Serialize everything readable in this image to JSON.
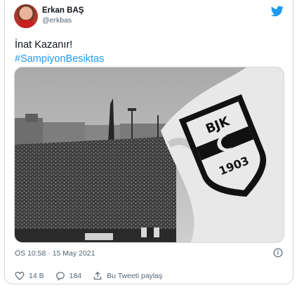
{
  "author": {
    "name": "Erkan BAŞ",
    "handle": "@erkbas"
  },
  "tweet": {
    "text": "İnat Kazanır!",
    "hashtag": "#SampiyonBesiktas",
    "timestamp": "ÖS 10:58 · 15 May 2021"
  },
  "media": {
    "flag_text": "BJK 1903"
  },
  "actions": {
    "likes": "14 B",
    "replies": "184",
    "share_label": "Bu Tweeti paylaş"
  },
  "colors": {
    "accent": "#1d9bf0",
    "secondary_text": "#536471",
    "border": "#cfd9de"
  },
  "icons": [
    "twitter-bird-icon",
    "info-icon",
    "heart-icon",
    "reply-icon",
    "share-icon"
  ]
}
